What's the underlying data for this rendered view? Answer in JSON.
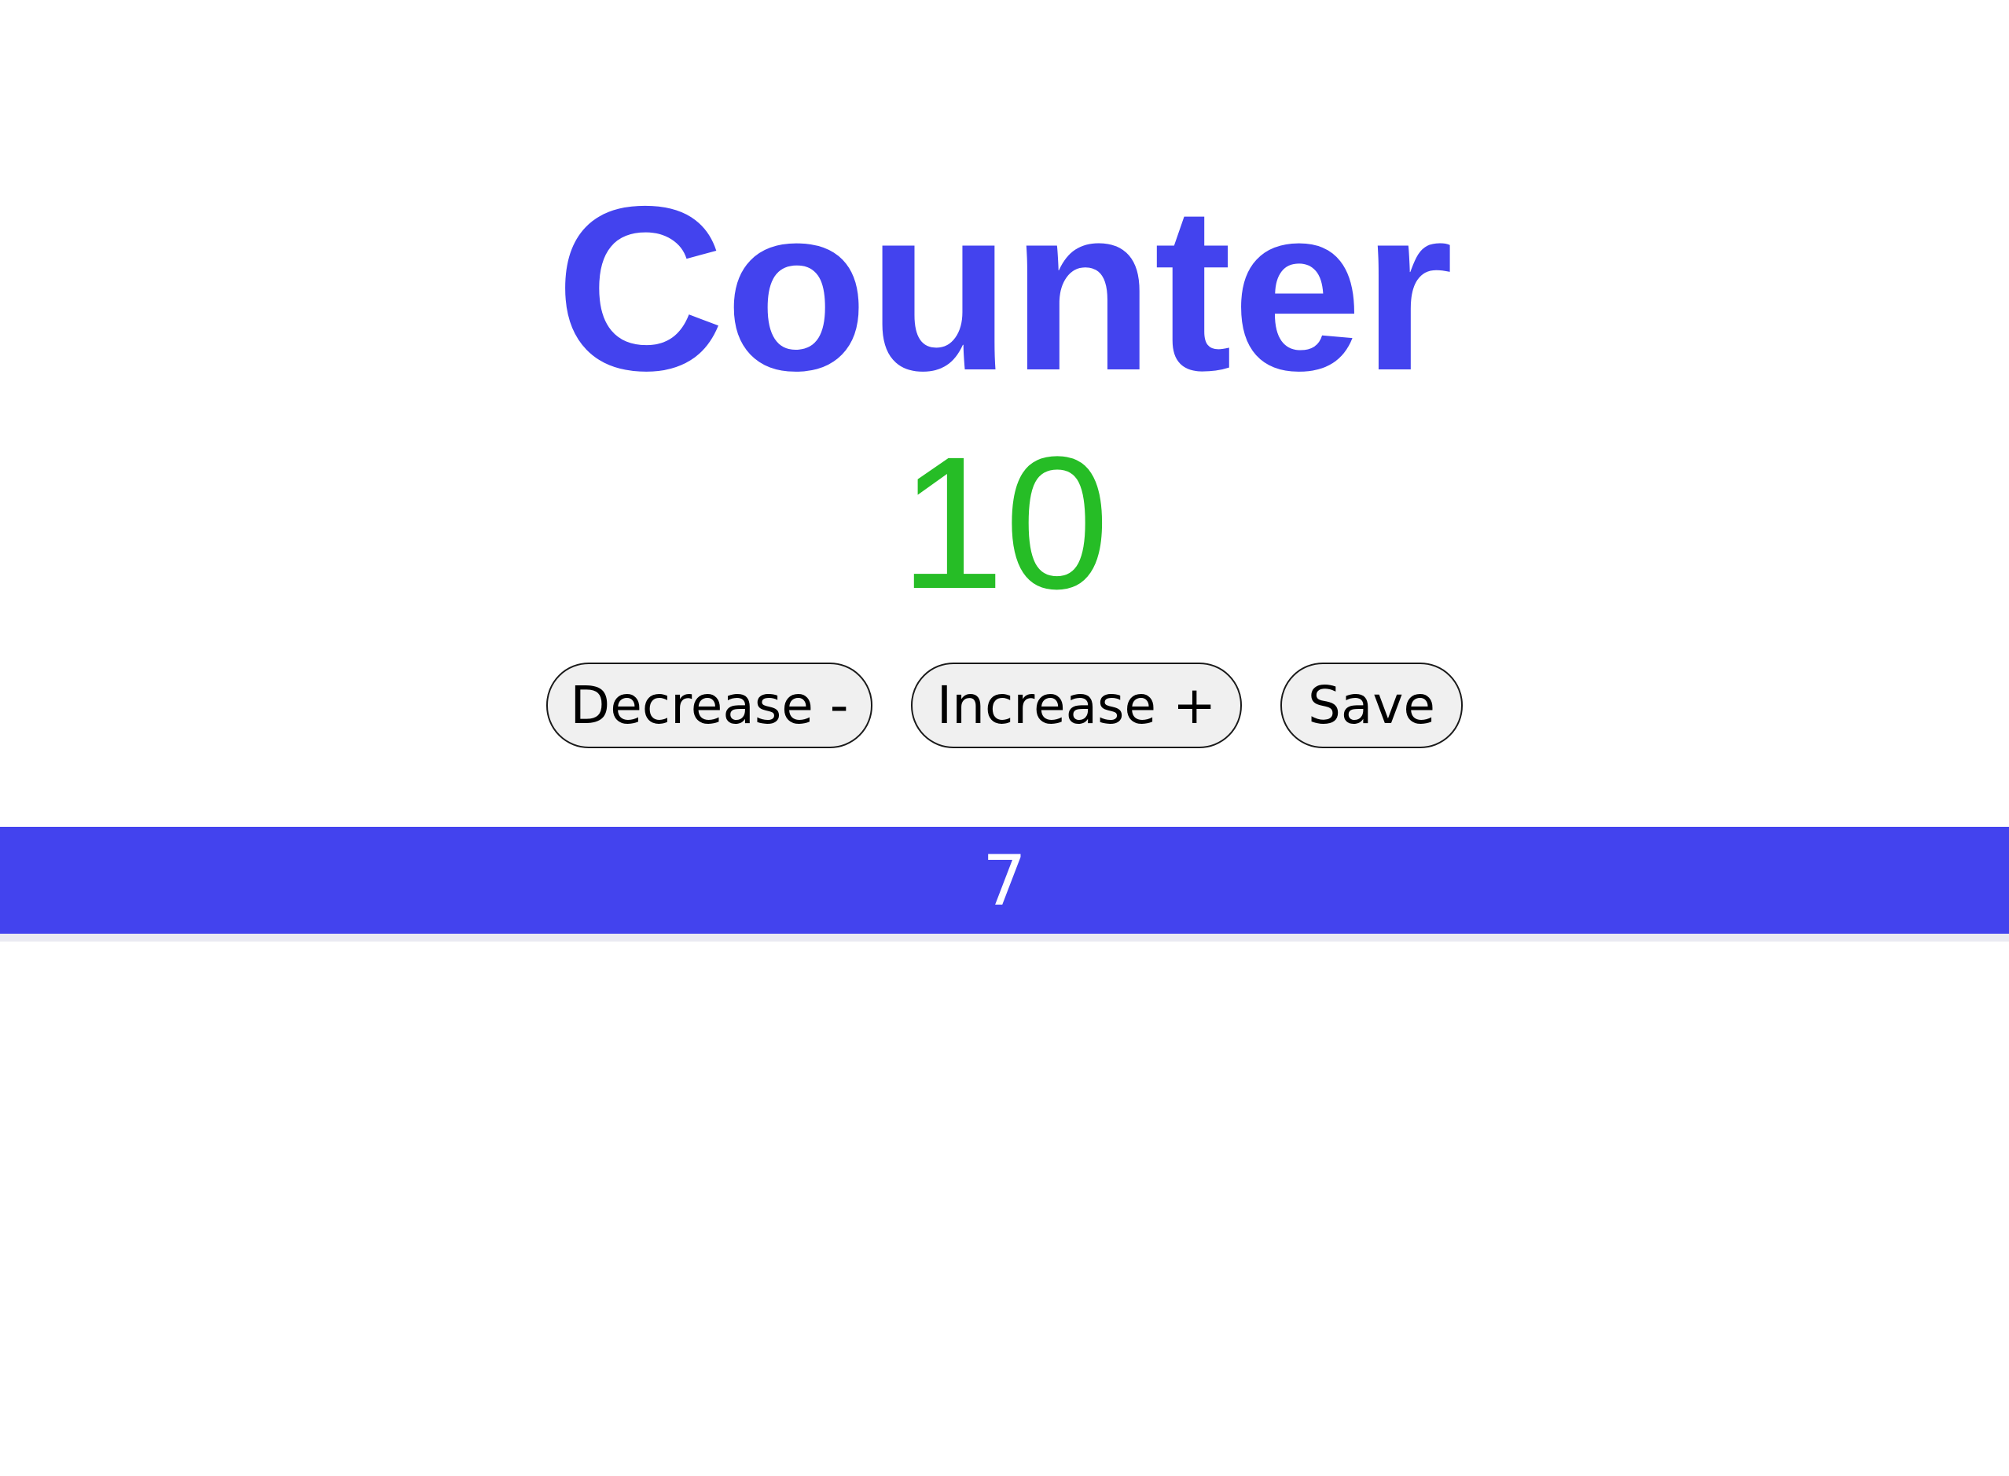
{
  "header": {
    "title": "Counter"
  },
  "counter": {
    "value": "10"
  },
  "controls": {
    "decrease_label": "Decrease -",
    "increase_label": "Increase +",
    "save_label": "Save"
  },
  "saved_bar": {
    "value": "7"
  },
  "colors": {
    "accent": "#4343ee",
    "count": "#26bd26",
    "button_bg": "#f0f0f0"
  }
}
